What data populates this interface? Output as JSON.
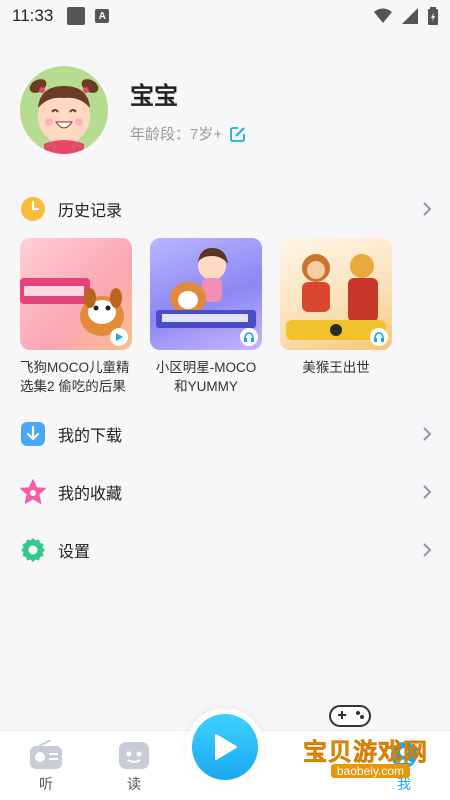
{
  "status_bar": {
    "time": "11:33",
    "a_icon": "A"
  },
  "profile": {
    "name": "宝宝",
    "age_label": "年龄段：7岁+"
  },
  "rows": {
    "history": "历史记录",
    "download": "我的下载",
    "favorites": "我的收藏",
    "settings": "设置"
  },
  "history_items": [
    {
      "title": "飞狗MOCO儿童精选集2 偷吃的后果"
    },
    {
      "title": "小区明星-MOCO和YUMMY"
    },
    {
      "title": "美猴王出世"
    }
  ],
  "bottom_nav": {
    "listen": "听",
    "read": "读",
    "me": "我"
  },
  "watermark": {
    "text": "宝贝游戏网",
    "url": "baobeiy.com"
  },
  "colors": {
    "accent": "#1aa8f0",
    "history_icon": "#f9bd3c",
    "download_icon": "#4aa7f5",
    "favorites_icon": "#f35ea6",
    "settings_icon": "#35c88c"
  }
}
